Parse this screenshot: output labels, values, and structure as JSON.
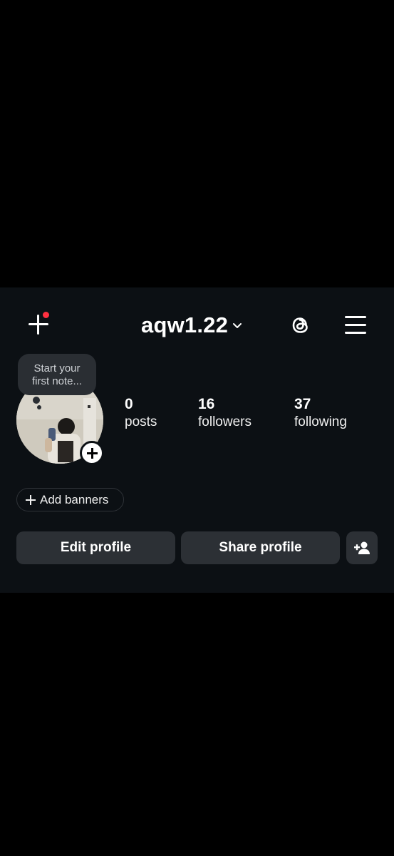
{
  "header": {
    "username": "aqw1.22"
  },
  "note": {
    "line1": "Start your",
    "line2": "first note..."
  },
  "stats": [
    {
      "value": "0",
      "label": "posts"
    },
    {
      "value": "16",
      "label": "followers"
    },
    {
      "value": "37",
      "label": "following"
    }
  ],
  "banners": {
    "label": "Add banners"
  },
  "buttons": {
    "edit": "Edit profile",
    "share": "Share profile"
  },
  "icons": {
    "create": "plus-icon",
    "notification": "red-dot-badge",
    "switch_account": "chevron-down-icon",
    "threads": "threads-icon",
    "menu": "hamburger-menu-icon",
    "add_story": "plus-circle-icon",
    "discover_people": "add-person-icon"
  },
  "colors": {
    "background": "#0c1014",
    "badge": "#ff3040",
    "button": "#2c3035"
  }
}
